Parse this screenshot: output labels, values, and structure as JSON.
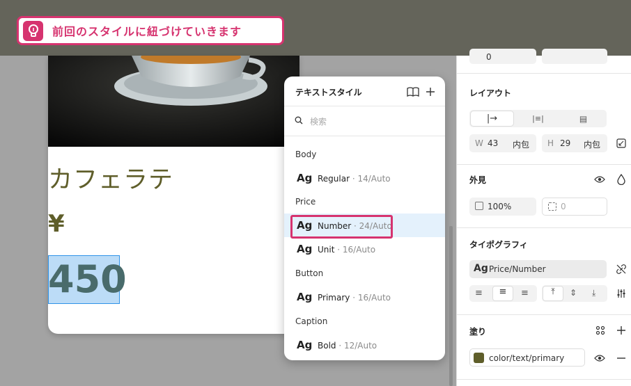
{
  "hint": {
    "text": "前回のスタイルに紐づけていきます",
    "accent": "#d6336f",
    "icon": "lightbulb-icon"
  },
  "card": {
    "product_name": "カフェラテ",
    "currency": "¥",
    "price": "450"
  },
  "text_style_panel": {
    "title": "テキストスタイル",
    "search_placeholder": "検索",
    "groups": [
      {
        "label": "Body",
        "items": [
          {
            "sample": "Ag",
            "name": "Regular",
            "meta": " · 14/Auto"
          }
        ]
      },
      {
        "label": "Price",
        "items": [
          {
            "sample": "Ag",
            "name": "Number",
            "meta": " · 24/Auto",
            "selected": true
          },
          {
            "sample": "Ag",
            "name": "Unit",
            "meta": " · 16/Auto"
          }
        ]
      },
      {
        "label": "Button",
        "items": [
          {
            "sample": "Ag",
            "name": "Primary",
            "meta": " · 16/Auto"
          }
        ]
      },
      {
        "label": "Caption",
        "items": [
          {
            "sample": "Ag",
            "name": "Bold",
            "meta": " · 12/Auto"
          }
        ]
      }
    ]
  },
  "properties": {
    "rotation_value": "0",
    "layout": {
      "title": "レイアウト",
      "w_label": "W",
      "w_value": "43",
      "w_mode": "内包",
      "h_label": "H",
      "h_value": "29",
      "h_mode": "内包"
    },
    "appearance": {
      "title": "外見",
      "opacity": "100%",
      "radius": "0"
    },
    "typography": {
      "title": "タイポグラフィ",
      "style_sample": "Ag",
      "style_name": "Price/Number"
    },
    "fill": {
      "title": "塗り",
      "variable": "color/text/primary",
      "swatch": "#5f5e2a"
    }
  }
}
